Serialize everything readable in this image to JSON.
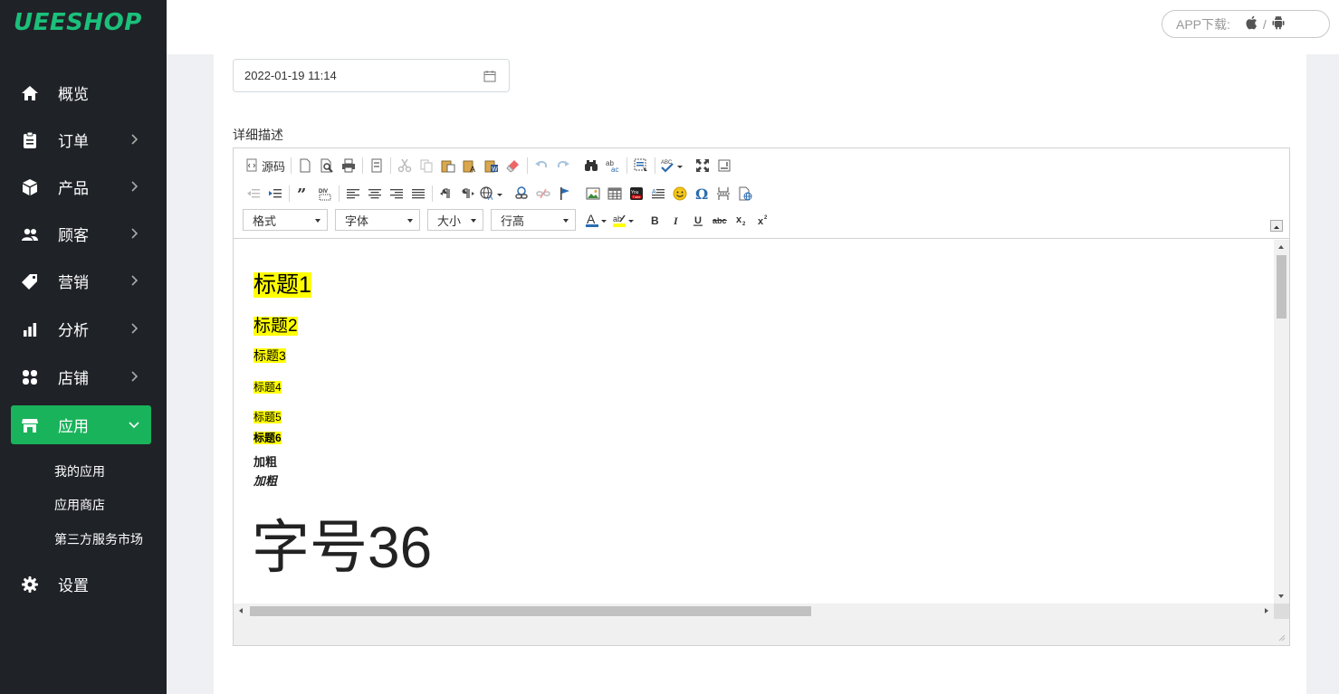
{
  "brand": {
    "logo": "UEESHOP"
  },
  "sidebar": {
    "items": [
      {
        "label": "概览",
        "icon": "home-icon",
        "has_arrow": false
      },
      {
        "label": "订单",
        "icon": "clipboard-icon",
        "has_arrow": true
      },
      {
        "label": "产品",
        "icon": "box-icon",
        "has_arrow": true
      },
      {
        "label": "顾客",
        "icon": "users-icon",
        "has_arrow": true
      },
      {
        "label": "营销",
        "icon": "tag-icon",
        "has_arrow": true
      },
      {
        "label": "分析",
        "icon": "bar-chart-icon",
        "has_arrow": true
      },
      {
        "label": "店铺",
        "icon": "grid-icon",
        "has_arrow": true
      },
      {
        "label": "应用",
        "icon": "store-icon",
        "has_arrow": true,
        "active": true
      },
      {
        "label": "设置",
        "icon": "gear-icon",
        "has_arrow": false
      }
    ],
    "sub_items": [
      "我的应用",
      "应用商店",
      "第三方服务市场"
    ],
    "active_color": "#19b35b"
  },
  "topbar": {
    "app_download_label": "APP下载:",
    "separator": "/"
  },
  "form": {
    "date_value": "2022-01-19 11:14",
    "description_label": "详细描述"
  },
  "editor": {
    "source_label": "源码",
    "combos": {
      "format": "格式",
      "font": "字体",
      "size": "大小",
      "line_height": "行高"
    },
    "content": {
      "h1": "标题1",
      "h2": "标题2",
      "h3": "标题3",
      "h4": "标题4",
      "h5": "标题5",
      "h6": "标题6",
      "bold": "加粗",
      "bold_italic": "加粗",
      "big": "字号36"
    },
    "highlight_color": "#ffff00"
  }
}
